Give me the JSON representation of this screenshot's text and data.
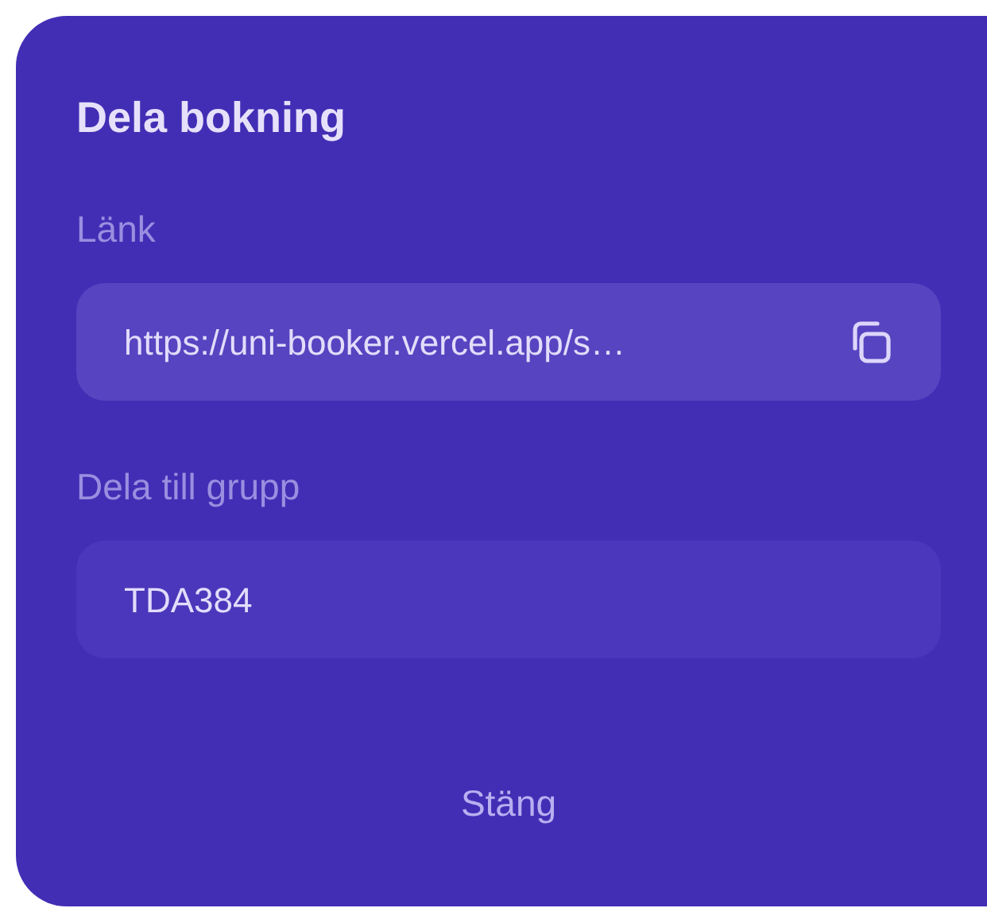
{
  "dialog": {
    "title": "Dela bokning",
    "fields": [
      {
        "label": "Länk",
        "value": "https://uni-booker.vercel.app/s…",
        "kind": "copy"
      },
      {
        "label": "Dela till grupp",
        "value": "TDA384",
        "kind": "text"
      }
    ],
    "close_button": "Stäng"
  }
}
